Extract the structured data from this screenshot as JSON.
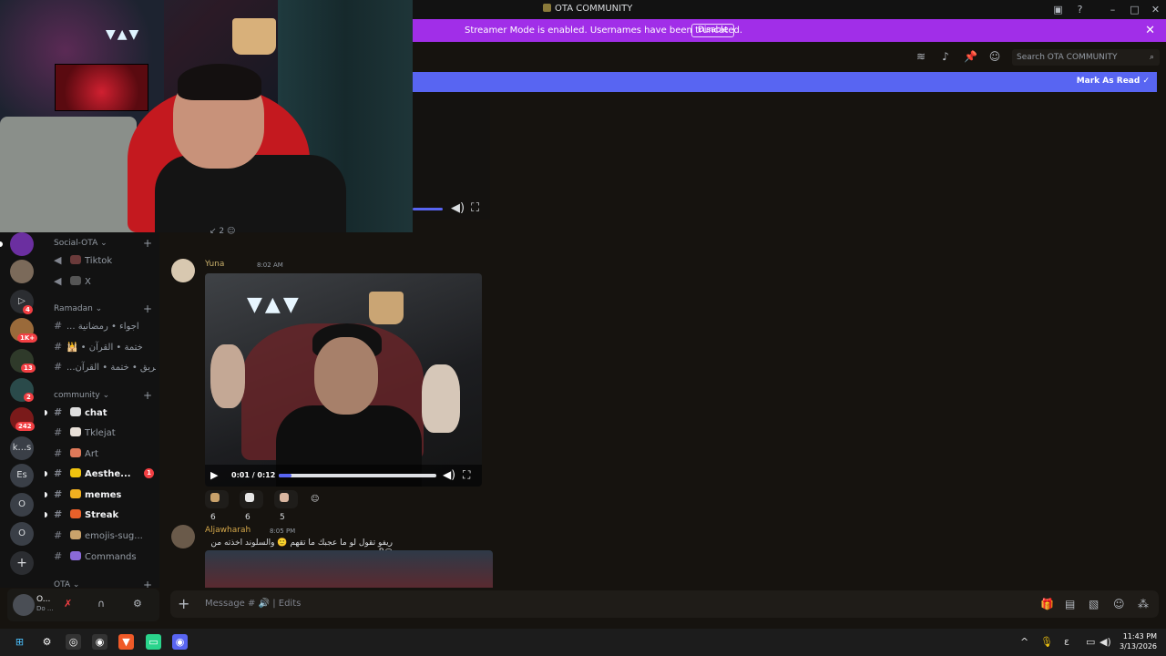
{
  "window": {
    "title": "OTA COMMUNITY"
  },
  "banner": {
    "message": "Streamer Mode is enabled. Usernames have been truncated.",
    "disable_label": "Disable"
  },
  "header": {
    "search_placeholder": "Search OTA COMMUNITY"
  },
  "markbar": {
    "label": "Mark As Read"
  },
  "rail": {
    "servers": [
      {
        "label": "",
        "badge": ""
      },
      {
        "label": "",
        "badge": ""
      },
      {
        "label": "",
        "badge": "4"
      },
      {
        "label": "",
        "badge": "1K+"
      },
      {
        "label": "",
        "badge": "13"
      },
      {
        "label": "",
        "badge": "2"
      },
      {
        "label": "",
        "badge": "242"
      },
      {
        "label": "k...s",
        "badge": ""
      },
      {
        "label": "Es",
        "badge": ""
      },
      {
        "label": "O",
        "badge": ""
      },
      {
        "label": "O",
        "badge": ""
      },
      {
        "label": "+",
        "badge": ""
      }
    ]
  },
  "channels": {
    "social_category": "Social-OTA",
    "social": [
      {
        "name": "Tiktok"
      },
      {
        "name": "X"
      }
    ],
    "ramadan_category": "Ramadan",
    "ramadan": [
      {
        "name": "... اجواء • رمضانية"
      },
      {
        "name": "🕌 • ختمة • القرآن"
      },
      {
        "name": "...فريق • ختمة • القرآن"
      }
    ],
    "community_category": "community",
    "community": [
      {
        "name": "chat",
        "bold": true
      },
      {
        "name": "Tklejat",
        "bold": false
      },
      {
        "name": "Art",
        "bold": false
      },
      {
        "name": "Aesthe...",
        "bold": true,
        "badge": "1"
      },
      {
        "name": "memes",
        "bold": true
      },
      {
        "name": "Streak",
        "bold": true
      },
      {
        "name": "emojis-sug...",
        "bold": false
      },
      {
        "name": "Commands",
        "bold": false
      }
    ],
    "ota_category": "OTA"
  },
  "user_panel": {
    "name": "O...",
    "status": "Do ..."
  },
  "messages": [
    {
      "author": "Yuna",
      "author_color": "#c9b06b",
      "time": "8:02 AM",
      "video": {
        "current": "0:01",
        "duration": "0:12",
        "progress_fraction": 0.08
      },
      "reactions": [
        {
          "count": "6"
        },
        {
          "count": "6"
        },
        {
          "count": "5"
        }
      ]
    },
    {
      "author": "Aljawharah",
      "author_color": "#d5a84a",
      "time": "8:05 PM",
      "text": "ريفو تقول لو ما عجبك ما تقهم 🙂 والسلوند اخذته من @R"
    }
  ],
  "top_reaction_count": "2",
  "composer": {
    "placeholder": "Message #",
    "edits_label": "Edits"
  },
  "taskbar": {
    "time": "11:43 PM",
    "date": "3/13/2026"
  },
  "colors": {
    "banner": "#a12ee8",
    "blurple": "#5865f2",
    "background": "#16130f"
  }
}
